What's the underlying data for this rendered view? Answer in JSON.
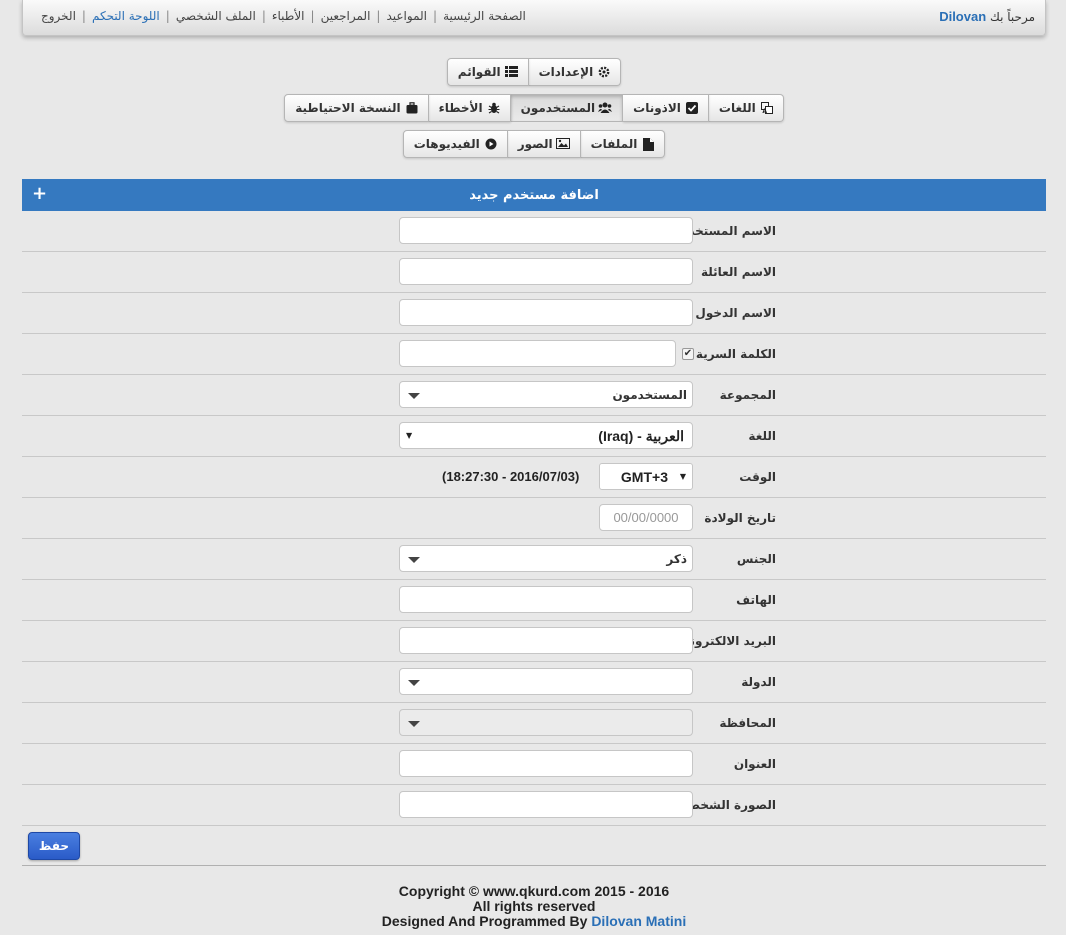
{
  "navbar": {
    "welcome_prefix": "مرحباً بك",
    "username": "Dilovan",
    "links": [
      {
        "label": "الصفحة الرئيسية",
        "active": false
      },
      {
        "label": "المواعيد",
        "active": false
      },
      {
        "label": "المراجعين",
        "active": false
      },
      {
        "label": "الأطباء",
        "active": false
      },
      {
        "label": "الملف الشخصي",
        "active": false
      },
      {
        "label": "اللوحة التحكم",
        "active": true
      },
      {
        "label": "الخروج",
        "active": false
      }
    ],
    "separator": "|"
  },
  "tabs": {
    "row1": [
      {
        "label": "الإعدادات",
        "icon": "gear-icon"
      },
      {
        "label": "القوائم",
        "icon": "list-icon"
      }
    ],
    "row2": [
      {
        "label": "اللغات",
        "icon": "language-icon"
      },
      {
        "label": "الاذونات",
        "icon": "check-square-icon"
      },
      {
        "label": "المستخدمون",
        "icon": "users-icon",
        "active": true
      },
      {
        "label": "الأخطاء",
        "icon": "bug-icon"
      },
      {
        "label": "النسخة الاحتياطية",
        "icon": "suitcase-icon"
      }
    ],
    "row3": [
      {
        "label": "الملفات",
        "icon": "file-icon"
      },
      {
        "label": "الصور",
        "icon": "image-icon"
      },
      {
        "label": "الفيديوهات",
        "icon": "play-circle-icon"
      }
    ]
  },
  "form": {
    "title": "اضافة مستخدم جديد",
    "add_symbol": "+",
    "fields": {
      "first_name": {
        "label": "الاسم المستخدم",
        "value": ""
      },
      "last_name": {
        "label": "الاسم العائلة",
        "value": ""
      },
      "login_name": {
        "label": "الاسم الدخول",
        "value": ""
      },
      "password": {
        "label": "الكلمة السرية",
        "value": "",
        "checkbox": "✔"
      },
      "group": {
        "label": "المجموعة",
        "value": "المستخدمون"
      },
      "language": {
        "label": "اللغة",
        "value": "العربية - (Iraq)"
      },
      "time": {
        "label": "الوقت",
        "timezone": "GMT+3",
        "current": "(2016/07/03 - 18:27:30)"
      },
      "birthdate": {
        "label": "تاريخ الولادة",
        "placeholder": "00/00/0000"
      },
      "gender": {
        "label": "الجنس",
        "value": "ذكر"
      },
      "phone": {
        "label": "الهاتف",
        "value": ""
      },
      "email": {
        "label": "البريد الالكتروني",
        "value": ""
      },
      "country": {
        "label": "الدولة",
        "value": ""
      },
      "province": {
        "label": "المحافظة",
        "value": ""
      },
      "address": {
        "label": "العنوان",
        "value": ""
      },
      "photo": {
        "label": "الصورة الشخصية",
        "value": ""
      }
    },
    "save_label": "حفظ"
  },
  "footer": {
    "copyright": "Copyright © www.qkurd.com 2015 - 2016",
    "rights": "All rights reserved",
    "designed_prefix": "Designed And Programmed By",
    "author": "Dilovan Matini"
  },
  "colors": {
    "accent": "#3579c0",
    "link": "#2a6fb6",
    "save": "#2a5bc8"
  }
}
